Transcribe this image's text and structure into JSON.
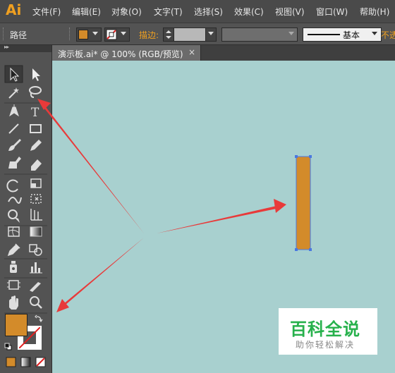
{
  "app": {
    "logo": "Ai"
  },
  "menu": [
    "文件(F)",
    "编辑(E)",
    "对象(O)",
    "文字(T)",
    "选择(S)",
    "效果(C)",
    "视图(V)",
    "窗口(W)",
    "帮助(H)"
  ],
  "control_bar": {
    "selection_label": "路径",
    "fill_color": "#d38b2a",
    "stroke_label": "描边:",
    "stroke_profile": "基本",
    "opacity_label": "不透"
  },
  "tab": {
    "title": "演示板.ai* @ 100% (RGB/预览)",
    "close": "×"
  },
  "tools": [
    "selection-tool",
    "direct-selection-tool",
    "magic-wand-tool",
    "lasso-tool",
    "pen-tool",
    "type-tool",
    "line-segment-tool",
    "rectangle-tool",
    "paintbrush-tool",
    "pencil-tool",
    "blob-brush-tool",
    "eraser-tool",
    "rotate-tool",
    "scale-tool",
    "width-tool",
    "free-transform-tool",
    "shape-builder-tool",
    "perspective-grid-tool",
    "mesh-tool",
    "gradient-tool",
    "eyedropper-tool",
    "blend-tool",
    "symbol-sprayer-tool",
    "column-graph-tool",
    "artboard-tool",
    "slice-tool",
    "hand-tool",
    "zoom-tool"
  ],
  "type_tool_glyph": "T",
  "colors": {
    "fill": "#d38b2a",
    "canvas": "#a8d0cf",
    "shape_fill": "#d38b2a",
    "selection_accent": "#4a78e0",
    "arrow": "#e83a3a",
    "watermark_green": "#27b14c"
  },
  "watermark": {
    "main": "百科全说",
    "sub": "助你轻松解决"
  }
}
